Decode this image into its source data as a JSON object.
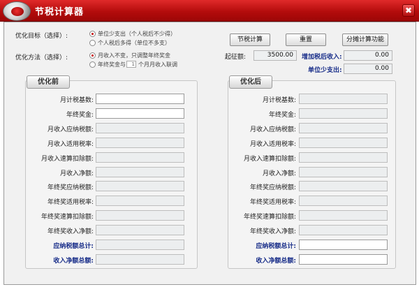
{
  "window": {
    "title": "节税计算器",
    "close_glyph": "✖",
    "logo_icon": "app-logo-icon",
    "accent": "#c00000"
  },
  "target": {
    "label": "优化目标（选择）:",
    "options": [
      {
        "label": "单位少支出（个人税后不少得）",
        "selected": true
      },
      {
        "label": "个人税后多得（单位不多支）",
        "selected": false
      }
    ]
  },
  "method": {
    "label": "优化方法（选择）:",
    "options": [
      {
        "label": "月收入不变，只调整年终奖金",
        "selected": true
      },
      {
        "label_prefix": "年终奖金与",
        "spin_value": "1",
        "label_suffix": "个月月收入联调",
        "selected": false
      }
    ]
  },
  "toolbar": {
    "calc_label": "节税计算",
    "reset_label": "重置",
    "split_label": "分摊计算功能"
  },
  "summary": {
    "threshold_label": "起征额:",
    "threshold_value": "3500.00",
    "added_income_label": "增加税后收入:",
    "added_income_value": "0.00",
    "unit_saving_label": "单位少支出:",
    "unit_saving_value": "0.00"
  },
  "before": {
    "tab": "优化前",
    "rows": [
      {
        "label": "月计税基数:",
        "value": ""
      },
      {
        "label": "年终奖金:",
        "value": ""
      },
      {
        "label": "月收入应纳税额:",
        "value": ""
      },
      {
        "label": "月收入适用税率:",
        "value": ""
      },
      {
        "label": "月收入速算扣除额:",
        "value": ""
      },
      {
        "label": "月收入净额:",
        "value": ""
      },
      {
        "label": "年终奖应纳税额:",
        "value": ""
      },
      {
        "label": "年终奖适用税率:",
        "value": ""
      },
      {
        "label": "年终奖速算扣除额:",
        "value": ""
      },
      {
        "label": "年终奖收入净额:",
        "value": ""
      },
      {
        "label": "应纳税额总计:",
        "value": ""
      },
      {
        "label": "收入净额总额:",
        "value": ""
      }
    ]
  },
  "after": {
    "tab": "优化后",
    "rows": [
      {
        "label": "月计税基数:",
        "value": ""
      },
      {
        "label": "年终奖金:",
        "value": ""
      },
      {
        "label": "月收入应纳税额:",
        "value": ""
      },
      {
        "label": "月收入适用税率:",
        "value": ""
      },
      {
        "label": "月收入速算扣除额:",
        "value": ""
      },
      {
        "label": "月收入净额:",
        "value": ""
      },
      {
        "label": "年终奖应纳税额:",
        "value": ""
      },
      {
        "label": "年终奖适用税率:",
        "value": ""
      },
      {
        "label": "年终奖速算扣除额:",
        "value": ""
      },
      {
        "label": "年终奖收入净额:",
        "value": ""
      },
      {
        "label": "应纳税额总计:",
        "value": ""
      },
      {
        "label": "收入净额总额:",
        "value": ""
      }
    ]
  }
}
